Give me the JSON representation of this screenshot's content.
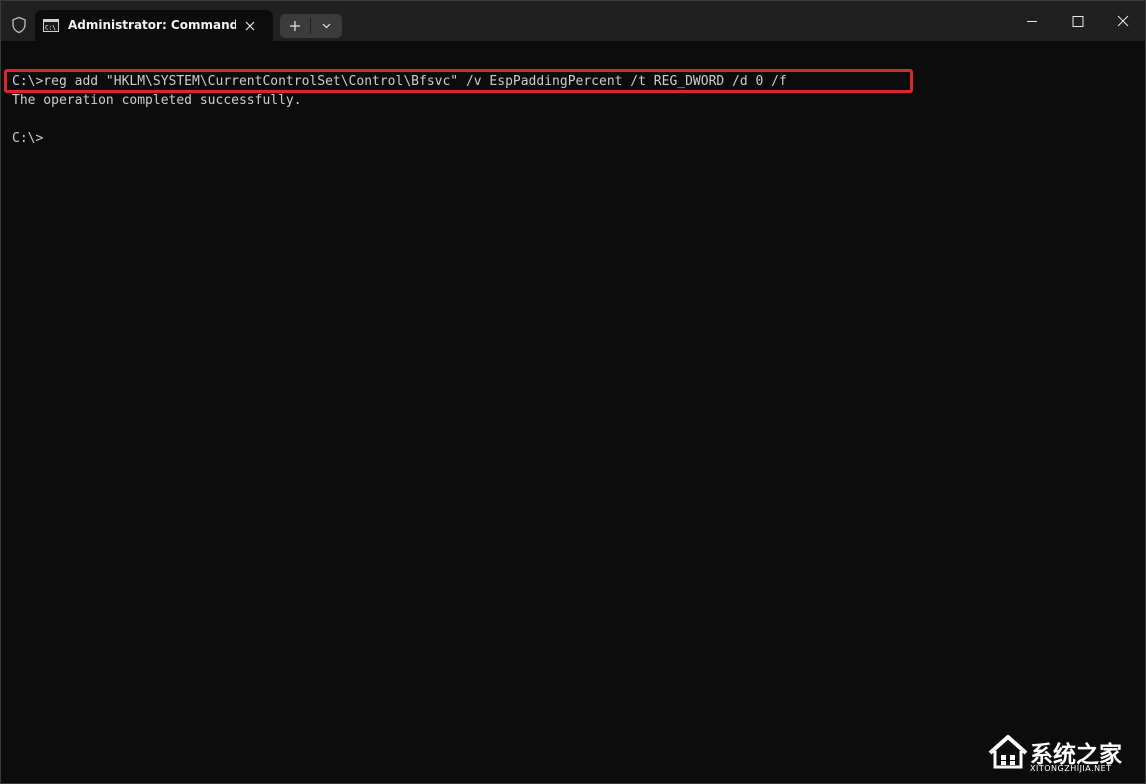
{
  "window": {
    "tab_title": "Administrator: Command Pro"
  },
  "icons": {
    "shield": "shield-icon",
    "tab": "command-prompt-icon",
    "tab_close": "close-icon",
    "new_tab": "plus-icon",
    "dropdown": "chevron-down-icon",
    "minimize": "minimize-icon",
    "maximize": "maximize-icon",
    "close": "close-icon"
  },
  "terminal": {
    "lines": [
      "C:\\>reg add \"HKLM\\SYSTEM\\CurrentControlSet\\Control\\Bfsvc\" /v EspPaddingPercent /t REG_DWORD /d 0 /f",
      "The operation completed successfully.",
      "C:\\>"
    ]
  },
  "colors": {
    "titlebar_bg": "#202020",
    "terminal_bg": "#0c0c0c",
    "terminal_text": "#cccccc",
    "highlight": "#e0242c"
  },
  "watermark": {
    "brand": "系统之家",
    "domain": "XITONGZHIJIA.NET"
  }
}
